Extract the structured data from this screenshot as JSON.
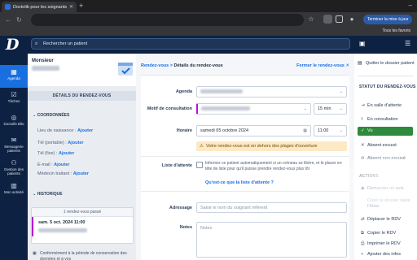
{
  "browser": {
    "tab_title": "Doctolib pour les soignants et",
    "update_button": "Terminer la mise à jour",
    "bookmarks_all": "Tous les favoris"
  },
  "app": {
    "search_placeholder": "Rechercher un patient"
  },
  "nav": {
    "items": [
      {
        "label": "Agenda",
        "icon": "calendar-icon"
      },
      {
        "label": "Tâches",
        "icon": "tasks-icon"
      },
      {
        "label": "Doctolib Bilo",
        "icon": "bilo-icon"
      },
      {
        "label": "Messagerie patients",
        "icon": "chat-icon"
      },
      {
        "label": "Gestion des patients",
        "icon": "patients-icon"
      },
      {
        "label": "Mon activité",
        "icon": "chart-icon"
      }
    ]
  },
  "patient": {
    "title": "Monsieur",
    "details_header": "DÉTAILS DU RENDEZ-VOUS",
    "coords_header": "COORDONNÉES",
    "rows": [
      {
        "label": "Lieu de naissance :",
        "link": "Ajouter"
      },
      {
        "label": "Tél (portable) :",
        "link": "Ajouter"
      },
      {
        "label": "Tél (fixe) :",
        "link": "Ajouter"
      },
      {
        "label": "E-mail :",
        "link": "Ajouter"
      },
      {
        "label": "Médecin traitant :",
        "link": "Ajouter"
      }
    ],
    "history_header": "HISTORIQUE",
    "history_top": "1 rendez-vous passé",
    "history_date": "sam. 5 oct. 2024 11:00",
    "conformity": "Conformément à la période de conservation des données et à vos"
  },
  "main": {
    "crumb_link": "Rendez-vous",
    "crumb_sep": ">",
    "crumb_current": "Détails du rendez-vous",
    "close_link": "Fermer le rendez-vous",
    "labels": {
      "agenda": "Agenda",
      "motif": "Motif de consultation",
      "horaire": "Horaire",
      "liste": "Liste d'attente",
      "adressage": "Adressage",
      "notes": "Notes"
    },
    "duration": "15 min",
    "date": "samedi 05 octobre 2024",
    "time": "11:00",
    "time_end": "11:00",
    "warning": "Votre rendez-vous est en dehors des plages d'ouverture",
    "waitlist_text": "Informer ce patient automatiquement si un créneau se libère, et le placer en tête de liste pour qu'il puisse prendre rendez-vous plus tôt",
    "waitlist_link": "Qu'est-ce que la liste d'attente ?",
    "adressage_placeholder": "Saisir le nom du soignant référent",
    "notes_placeholder": "Notes"
  },
  "right": {
    "quit": "Quitter le dossier patient",
    "status_header": "STATUT DU RENDEZ-VOUS",
    "status": [
      "En salle d'attente",
      "En consultation",
      "Vu",
      "Absent excusé",
      "Absent non excusé"
    ],
    "actions_header": "ACTIONS",
    "actions": [
      "Demander un avis",
      "Créer le dossier dans l'Atlas",
      "Déplacer le RDV",
      "Copier le RDV",
      "Imprimer le RDV",
      "Ajouter des infos"
    ]
  },
  "colors": {
    "brand_navy": "#0d2242",
    "accent_blue": "#1a6fe0",
    "vu_green": "#2e8a3c",
    "motif_purple": "#b012d8",
    "warning_bg": "#fde9c4"
  }
}
